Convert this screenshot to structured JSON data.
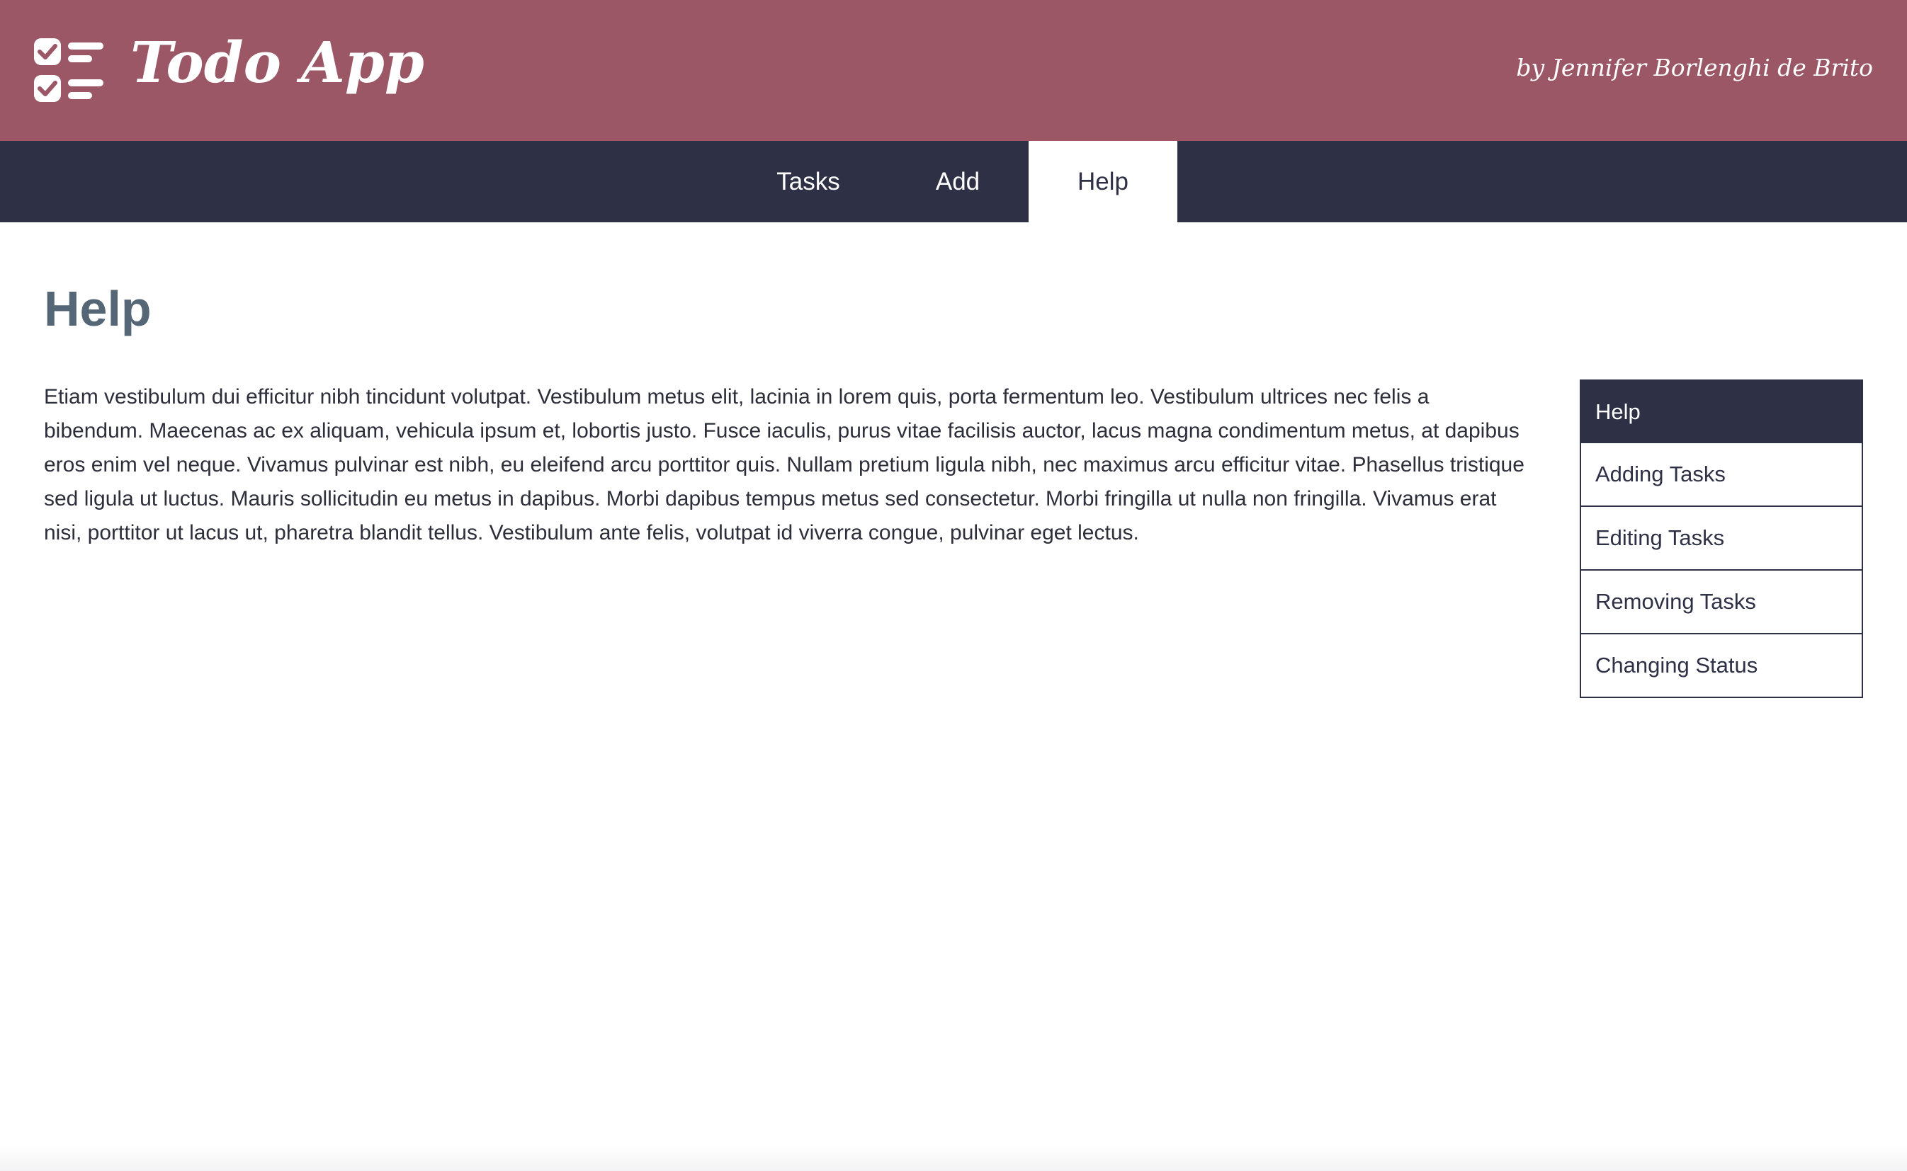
{
  "header": {
    "title": "Todo App",
    "byline": "by Jennifer Borlenghi de Brito",
    "logo_icon": "checklist-icon",
    "background_color": "#9b5765"
  },
  "nav": {
    "background_color": "#2e3145",
    "tabs": [
      {
        "label": "Tasks",
        "active": false
      },
      {
        "label": "Add",
        "active": false
      },
      {
        "label": "Help",
        "active": true
      }
    ]
  },
  "main": {
    "title": "Help",
    "body": "Etiam vestibulum dui efficitur nibh tincidunt volutpat. Vestibulum metus elit, lacinia in lorem quis, porta fermentum leo. Vestibulum ultrices nec felis a bibendum. Maecenas ac ex aliquam, vehicula ipsum et, lobortis justo. Fusce iaculis, purus vitae facilisis auctor, lacus magna condimentum metus, at dapibus eros enim vel neque. Vivamus pulvinar est nibh, eu eleifend arcu porttitor quis. Nullam pretium ligula nibh, nec maximus arcu efficitur vitae. Phasellus tristique sed ligula ut luctus. Mauris sollicitudin eu metus in dapibus. Morbi dapibus tempus metus sed consectetur. Morbi fringilla ut nulla non fringilla. Vivamus erat nisi, porttitor ut lacus ut, pharetra blandit tellus. Vestibulum ante felis, volutpat id viverra congue, pulvinar eget lectus."
  },
  "side_menu": {
    "items": [
      {
        "label": "Help",
        "active": true
      },
      {
        "label": "Adding Tasks",
        "active": false
      },
      {
        "label": "Editing Tasks",
        "active": false
      },
      {
        "label": "Removing Tasks",
        "active": false
      },
      {
        "label": "Changing Status",
        "active": false
      }
    ]
  }
}
